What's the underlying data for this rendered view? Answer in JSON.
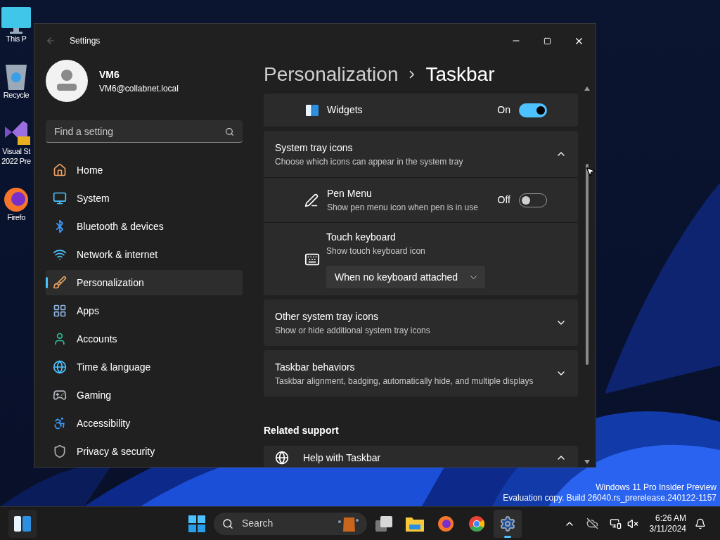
{
  "desktop_icons": [
    {
      "lines": [
        "This P"
      ]
    },
    {
      "lines": [
        "Recycle"
      ]
    },
    {
      "lines": [
        "Visual St",
        "2022 Pre"
      ]
    },
    {
      "lines": [
        "Firefo"
      ]
    }
  ],
  "window": {
    "title": "Settings"
  },
  "user": {
    "name": "VM6",
    "email": "VM6@collabnet.local"
  },
  "search": {
    "placeholder": "Find a setting"
  },
  "nav": [
    {
      "label": "Home",
      "selected": false
    },
    {
      "label": "System",
      "selected": false
    },
    {
      "label": "Bluetooth & devices",
      "selected": false
    },
    {
      "label": "Network & internet",
      "selected": false
    },
    {
      "label": "Personalization",
      "selected": true
    },
    {
      "label": "Apps",
      "selected": false
    },
    {
      "label": "Accounts",
      "selected": false
    },
    {
      "label": "Time & language",
      "selected": false
    },
    {
      "label": "Gaming",
      "selected": false
    },
    {
      "label": "Accessibility",
      "selected": false
    },
    {
      "label": "Privacy & security",
      "selected": false
    }
  ],
  "breadcrumb": {
    "parent": "Personalization",
    "current": "Taskbar"
  },
  "settings": [
    {
      "kind": "toggle",
      "title": "Widgets",
      "state_label": "On",
      "on": true
    },
    {
      "kind": "expander",
      "title": "System tray icons",
      "subtitle": "Choose which icons can appear in the system tray",
      "expanded": true,
      "children": [
        {
          "kind": "toggle",
          "title": "Pen Menu",
          "subtitle": "Show pen menu icon when pen is in use",
          "state_label": "Off",
          "on": false
        },
        {
          "kind": "dropdown",
          "title": "Touch keyboard",
          "subtitle": "Show touch keyboard icon",
          "value": "When no keyboard attached"
        }
      ]
    },
    {
      "kind": "expander",
      "title": "Other system tray icons",
      "subtitle": "Show or hide additional system tray icons",
      "expanded": false
    },
    {
      "kind": "expander",
      "title": "Taskbar behaviors",
      "subtitle": "Taskbar alignment, badging, automatically hide, and multiple displays",
      "expanded": false
    }
  ],
  "related_support": {
    "title": "Related support",
    "items": [
      {
        "label": "Help with Taskbar",
        "expanded": true
      }
    ]
  },
  "watermark": [
    "Windows 11 Pro Insider Preview",
    "Evaluation copy. Build 26040.rs_prerelease.240122-1157"
  ],
  "taskbar": {
    "search_placeholder": "Search",
    "apps": [
      {
        "selected": false
      },
      {
        "selected": false
      },
      {
        "selected": false
      },
      {
        "selected": false
      },
      {
        "selected": true
      }
    ],
    "time": "6:26 AM",
    "date": "3/11/2024"
  }
}
